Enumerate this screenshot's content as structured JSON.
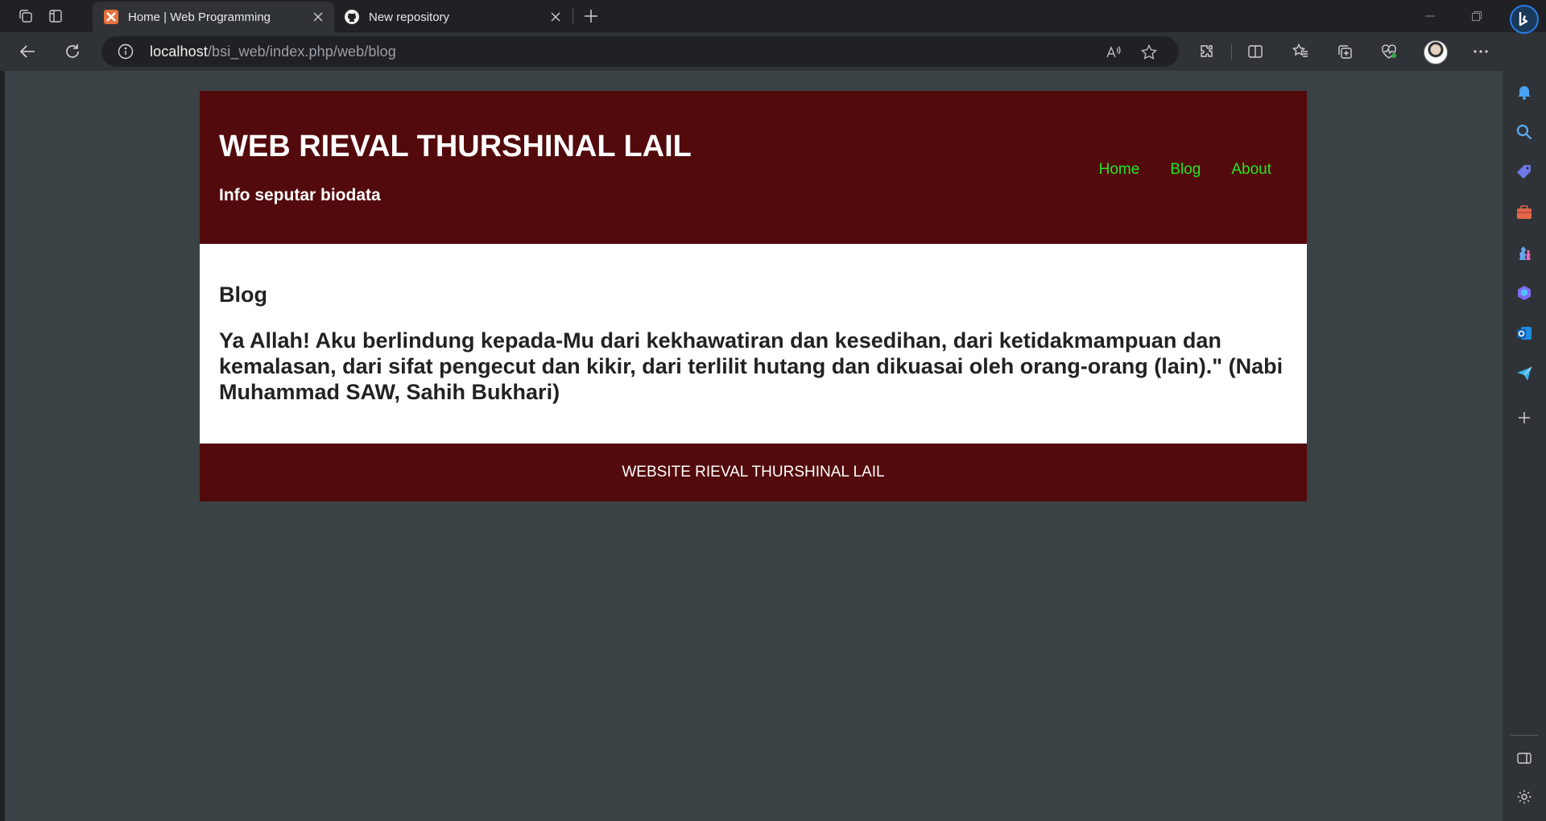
{
  "browser": {
    "tabs": [
      {
        "title": "Home | Web Programming",
        "active": true,
        "favicon": "xampp-icon",
        "color": "#e8713c"
      },
      {
        "title": "New repository",
        "active": false,
        "favicon": "github-icon"
      }
    ],
    "url": {
      "host": "localhost",
      "path": "/bsi_web/index.php/web/blog"
    },
    "sidebar_icons": [
      "bell-icon",
      "search-icon",
      "tag-icon",
      "briefcase-icon",
      "chess-icon",
      "copilot-icon",
      "outlook-icon",
      "send-icon",
      "plus-icon",
      "panel-icon",
      "gear-icon"
    ]
  },
  "site": {
    "title": "WEB RIEVAL THURSHINAL LAIL",
    "subtitle": "Info seputar biodata",
    "nav": [
      "Home",
      "Blog",
      "About"
    ],
    "nav_color": "#22e81e",
    "brand_color": "#530a0c",
    "page_heading": "Blog",
    "quote": "Ya Allah! Aku berlindung kepada-Mu dari kekhawatiran dan kesedihan, dari ketidakmampuan dan kemalasan, dari sifat pengecut dan kikir, dari terlilit hutang dan dikuasai oleh orang-orang (lain).\" (Nabi Muhammad SAW, Sahih Bukhari)",
    "footer": "WEBSITE RIEVAL THURSHINAL LAIL"
  }
}
